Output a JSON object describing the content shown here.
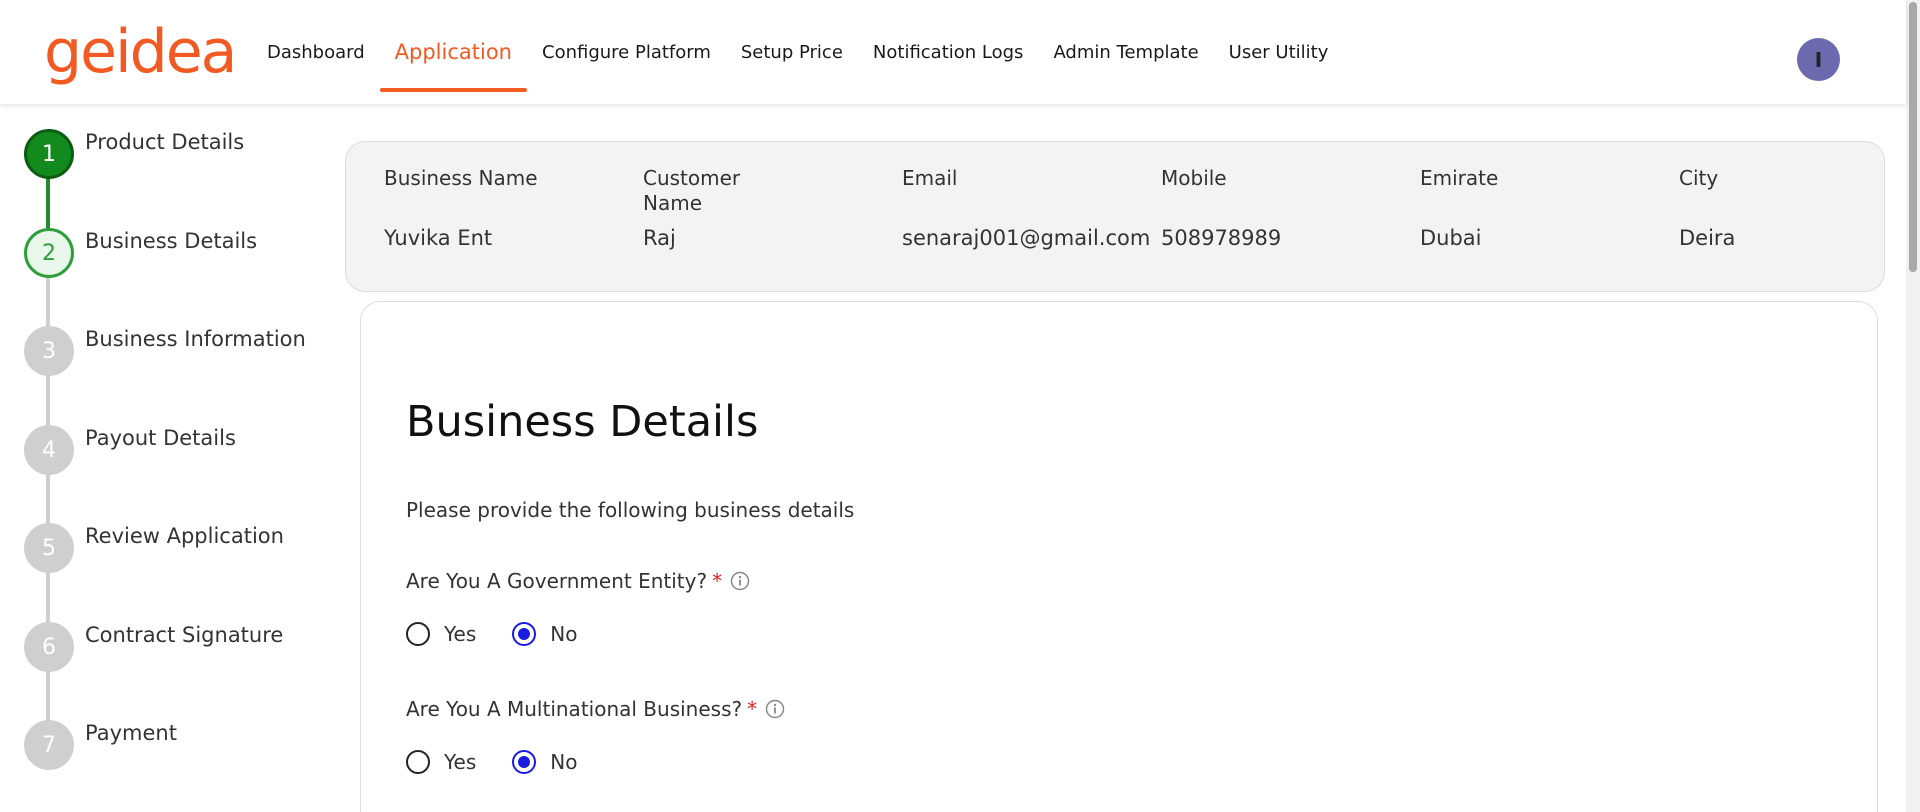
{
  "brand": {
    "logo_text": "geidea",
    "accent_color": "#f15a22"
  },
  "nav": {
    "items": [
      {
        "label": "Dashboard",
        "active": false
      },
      {
        "label": "Application",
        "active": true
      },
      {
        "label": "Configure Platform",
        "active": false
      },
      {
        "label": "Setup Price",
        "active": false
      },
      {
        "label": "Notification Logs",
        "active": false
      },
      {
        "label": "Admin Template",
        "active": false
      },
      {
        "label": "User Utility",
        "active": false
      }
    ],
    "avatar_initial": "I"
  },
  "stepper": {
    "steps": [
      {
        "number": "1",
        "label": "Product Details",
        "state": "completed"
      },
      {
        "number": "2",
        "label": "Business Details",
        "state": "current"
      },
      {
        "number": "3",
        "label": "Business Information",
        "state": "pending"
      },
      {
        "number": "4",
        "label": "Payout Details",
        "state": "pending"
      },
      {
        "number": "5",
        "label": "Review Application",
        "state": "pending"
      },
      {
        "number": "6",
        "label": "Contract Signature",
        "state": "pending"
      },
      {
        "number": "7",
        "label": "Payment",
        "state": "pending"
      }
    ]
  },
  "summary": {
    "columns": [
      {
        "header": "Business Name",
        "value": "Yuvika Ent"
      },
      {
        "header": "Customer Name",
        "value": "Raj"
      },
      {
        "header": "Email",
        "value": "senaraj001@gmail.com"
      },
      {
        "header": "Mobile",
        "value": "508978989"
      },
      {
        "header": "Emirate",
        "value": "Dubai"
      },
      {
        "header": "City",
        "value": "Deira"
      }
    ]
  },
  "form": {
    "title": "Business Details",
    "subtitle": "Please provide the following business details",
    "questions": [
      {
        "label": "Are You A Government Entity?",
        "required_mark": "*",
        "options": [
          "Yes",
          "No"
        ],
        "selected": "No"
      },
      {
        "label": "Are You A Multinational Business?",
        "required_mark": "*",
        "options": [
          "Yes",
          "No"
        ],
        "selected": "No"
      }
    ]
  }
}
